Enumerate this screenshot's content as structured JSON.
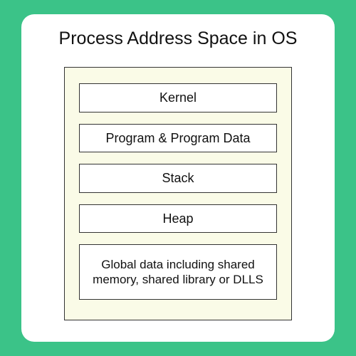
{
  "title": "Process Address Space in OS",
  "segments": [
    {
      "label": "Kernel"
    },
    {
      "label": "Program & Program Data"
    },
    {
      "label": "Stack"
    },
    {
      "label": "Heap"
    },
    {
      "label": "Global data including shared memory, shared library or DLLS"
    }
  ]
}
